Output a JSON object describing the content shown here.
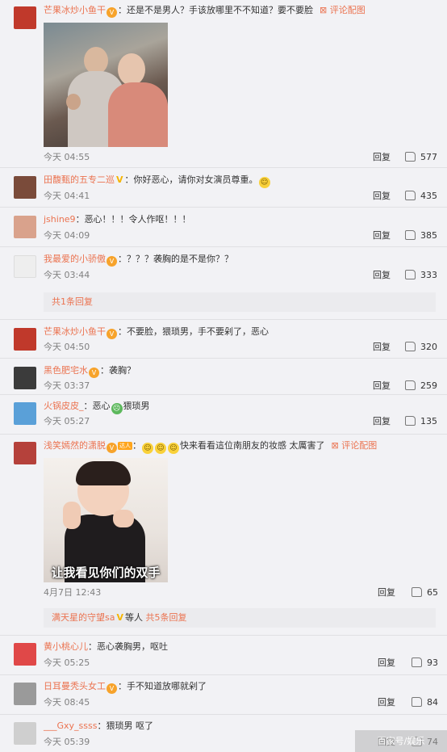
{
  "config_label": "评论配图",
  "reply_label": "回复",
  "colors": {
    "username": "#eb7350",
    "meta": "#808080",
    "background": "#f2f2f5",
    "subbar": "#ebebee"
  },
  "comments": [
    {
      "user": "芒果冰炒小鱼干",
      "text": "还是不是男人？手该放哪里不不知道？要不要脸",
      "time": "今天 04:55",
      "likes": "577",
      "avatar_color": "#c0392b"
    },
    {
      "user": "田馥甄的五专二巡",
      "text": "你好恶心，请你对女演员尊重。",
      "time": "今天 04:41",
      "likes": "435",
      "avatar_color": "#7a4b3a"
    },
    {
      "user": "jshine9",
      "text": "恶心！！！令人作呕！！！",
      "time": "今天 04:09",
      "likes": "385",
      "avatar_color": "#d9a28c"
    },
    {
      "user": "我最爱的小骄傲",
      "text": "？？？袭胸的是不是你？？",
      "time": "今天 03:44",
      "likes": "333",
      "avatar_color": "#e8e8e8"
    },
    {
      "user": "芒果冰炒小鱼干",
      "text": "不要脸，猥琐男，手不要剁了，恶心",
      "time": "今天 04:50",
      "likes": "320",
      "avatar_color": "#c0392b"
    },
    {
      "user": "黑色肥宅水",
      "text": "袭胸？",
      "time": "今天 03:37",
      "likes": "259",
      "avatar_color": "#3b3b3b"
    },
    {
      "user": "火锅皮皮_",
      "text_a": "恶心",
      "text_b": "猥琐男",
      "time": "今天 05:27",
      "likes": "135",
      "avatar_color": "#5aa0d8"
    },
    {
      "user": "浅笑嫣然的潇脱",
      "tag": "达人",
      "text": "快来看看這位南朋友的妆感 太厲害了",
      "time": "4月7日 12:43",
      "likes": "65",
      "avatar_color": "#b5413b",
      "image_caption": "让我看见你们的双手"
    },
    {
      "user": "黄小桃心儿",
      "text": "恶心袭胸男，呕吐",
      "time": "今天 05:25",
      "likes": "93",
      "avatar_color": "#e04848"
    },
    {
      "user": "日耳曼秃头女工",
      "text": "手不知道放哪就剁了",
      "time": "今天 08:45",
      "likes": "84",
      "avatar_color": "#9a9a9a"
    },
    {
      "user": "___Gxy_ssss",
      "text": "猥琐男 呕了",
      "time": "今天 05:39",
      "likes": "74",
      "avatar_color": "#cfcfcf"
    }
  ],
  "subreply1": {
    "link": "共1条回复"
  },
  "subreply2": {
    "user": "满天星的守望sa",
    "middle": "等人",
    "link": "共5条回复"
  },
  "watermark": "百家号/娱乐"
}
